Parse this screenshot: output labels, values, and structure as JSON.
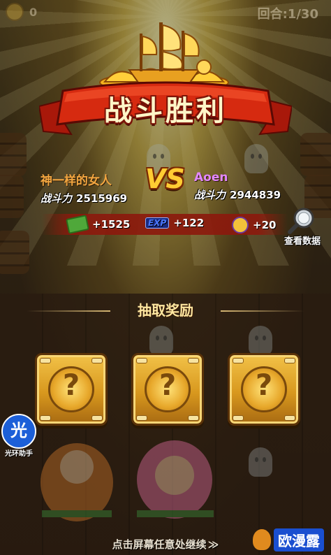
{
  "hud": {
    "coins": "0",
    "round": "回合:1/30"
  },
  "banner": {
    "title": "战斗胜利"
  },
  "vs_label": "VS",
  "player_left": {
    "name": "神一样的女人",
    "power_label": "战斗力",
    "power": "2515969"
  },
  "player_right": {
    "name": "Aoen",
    "power_label": "战斗力",
    "power": "2944839"
  },
  "rewards": {
    "money": "+1525",
    "exp_icon": "EXP",
    "exp": "+122",
    "badge": "+20"
  },
  "view_data_label": "查看数据",
  "draw_title": "抽取奖励",
  "cards": [
    {
      "symbol": "?"
    },
    {
      "symbol": "?"
    },
    {
      "symbol": "?"
    }
  ],
  "continue_text": "点击屏幕任意处继续",
  "continue_arrow": "≫",
  "watermark_left": {
    "glyph": "光",
    "caption": "光环助手"
  },
  "watermark_right": {
    "text": "欧漫露"
  },
  "colors": {
    "player_left_name": "#f3a640",
    "player_right_name": "#e287ff",
    "banner_red": "#c8260e",
    "card_gold": "#e2a528",
    "vs_yellow": "#ffcc33"
  },
  "icons": [
    "ship-emblem-icon",
    "money-icon",
    "exp-icon",
    "badge-icon",
    "magnifier-icon",
    "question-icon"
  ]
}
